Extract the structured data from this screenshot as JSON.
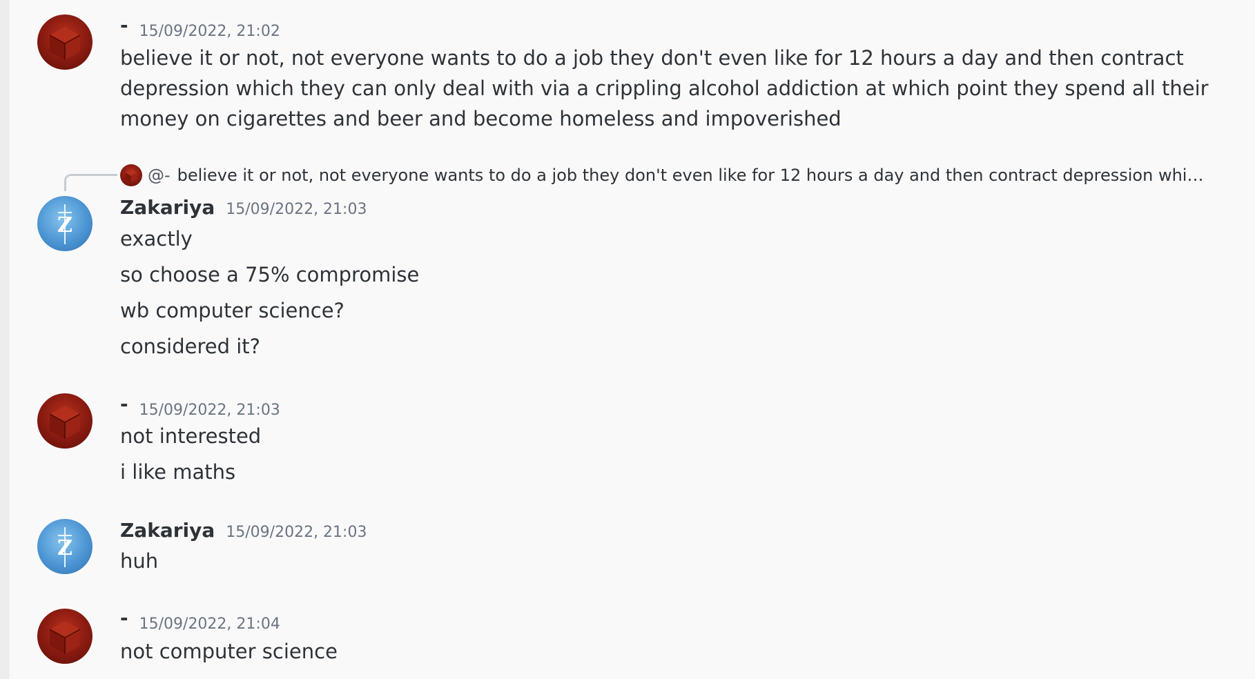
{
  "messages": [
    {
      "author": "-",
      "timestamp": "15/09/2022, 21:02",
      "lines": [
        "believe it or not, not everyone wants to do a job they don't even like for 12 hours a day and then contract depression which they can only deal with via a crippling alcohol addiction at which point they spend all their money on cigarettes and beer and become homeless and impoverished"
      ]
    },
    {
      "reply": {
        "author": "@-",
        "text": "believe it or not, not everyone wants to do a job they don't even like for 12 hours a day and then contract depression which th..."
      },
      "author": "Zakariya",
      "timestamp": "15/09/2022, 21:03",
      "lines": [
        "exactly",
        "so choose a 75% compromise",
        "wb computer science?",
        "considered it?"
      ]
    },
    {
      "author": "-",
      "timestamp": "15/09/2022, 21:03",
      "lines": [
        "not interested",
        "i like maths"
      ]
    },
    {
      "author": "Zakariya",
      "timestamp": "15/09/2022, 21:03",
      "lines": [
        "huh"
      ]
    },
    {
      "author": "-",
      "timestamp": "15/09/2022, 21:04",
      "lines": [
        "not computer science"
      ]
    }
  ],
  "icons": {
    "avatar_dash": "red-cube-avatar-icon",
    "avatar_zakariya": "blue-z-sword-avatar-icon",
    "reply_connector": "reply-spine-icon"
  },
  "colors": {
    "background": "#f9f9fa",
    "text": "#2e3338",
    "timestamp": "#6a7480",
    "reply_spine": "#c7ccd1"
  }
}
